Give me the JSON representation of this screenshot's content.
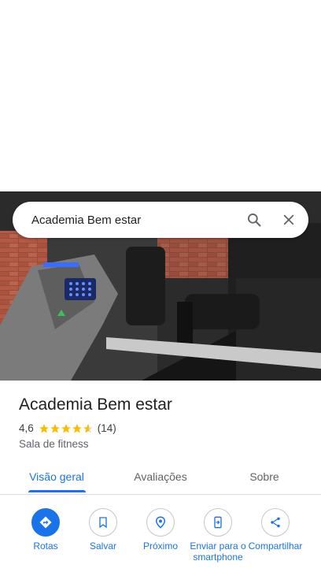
{
  "search": {
    "query": "Academia Bem estar"
  },
  "place": {
    "name": "Academia Bem estar",
    "rating": "4,6",
    "rating_value": 4.6,
    "review_count": "(14)",
    "category": "Sala de fitness"
  },
  "tabs": [
    {
      "label": "Visão geral",
      "active": true
    },
    {
      "label": "Avaliações",
      "active": false
    },
    {
      "label": "Sobre",
      "active": false
    }
  ],
  "actions": [
    {
      "label": "Rotas",
      "icon": "directions-icon"
    },
    {
      "label": "Salvar",
      "icon": "bookmark-icon"
    },
    {
      "label": "Próximo",
      "icon": "nearby-icon"
    },
    {
      "label": "Enviar para o smartphone",
      "icon": "send-to-phone-icon"
    },
    {
      "label": "Compartilhar",
      "icon": "share-icon"
    }
  ],
  "colors": {
    "accent": "#1a73e8",
    "star": "#fbbc04"
  }
}
